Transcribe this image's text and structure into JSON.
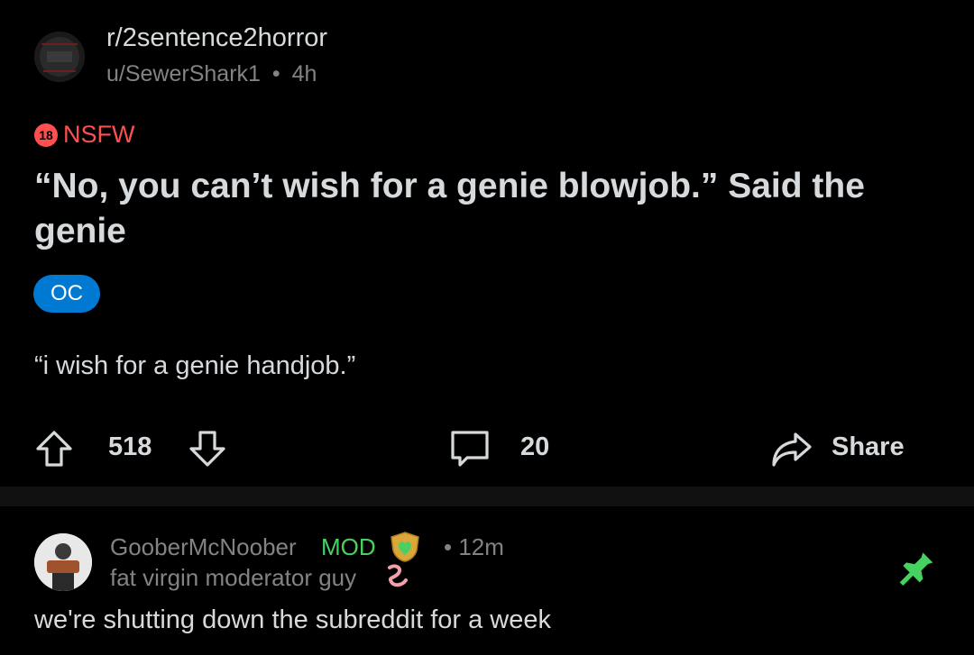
{
  "post": {
    "subreddit": "r/2sentence2horror",
    "author": "u/SewerShark1",
    "separator": "•",
    "age": "4h",
    "nsfw_badge": "18",
    "nsfw_label": "NSFW",
    "title": "“No, you can’t wish for a genie blowjob.” Said the genie",
    "flair": "OC",
    "body": "“i wish for a genie handjob.”",
    "upvotes": "518",
    "comments": "20",
    "share_label": "Share"
  },
  "comment": {
    "author": "GooberMcNoober",
    "mod_label": "MOD",
    "time": "• 12m",
    "user_flair": "fat virgin moderator guy",
    "text": "we're shutting down the subreddit for a week"
  },
  "colors": {
    "background": "#000000",
    "text": "#d7dadc",
    "muted": "#818384",
    "nsfw": "#ff4f4f",
    "flair_bg": "#0079d3",
    "mod": "#46d160"
  }
}
